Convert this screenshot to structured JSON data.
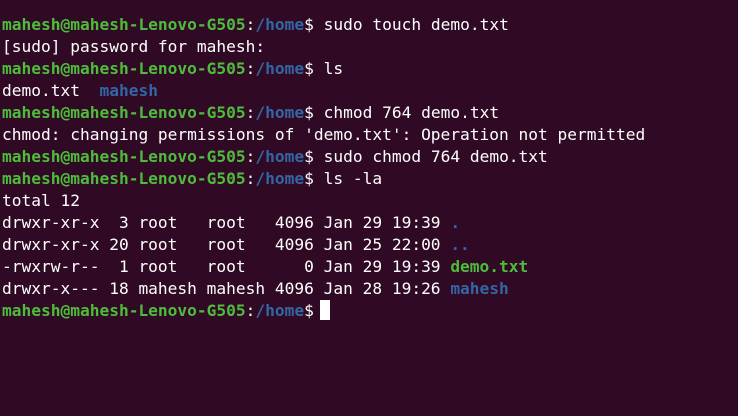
{
  "colors": {
    "background": "#300a24",
    "prompt_user": "#4ebc3b",
    "prompt_path": "#3465a4",
    "text": "#ffffff",
    "directory": "#3465a4",
    "executable": "#4ebc3b"
  },
  "prompt": {
    "user_host": "mahesh@mahesh-Lenovo-G505",
    "sep": ":",
    "path": "/home",
    "symbol": "$"
  },
  "lines": [
    {
      "type": "cmd",
      "command": "sudo touch demo.txt"
    },
    {
      "type": "out",
      "text": "[sudo] password for mahesh:"
    },
    {
      "type": "cmd",
      "command": "ls"
    },
    {
      "type": "ls",
      "file": "demo.txt",
      "gap": "  ",
      "dir": "mahesh"
    },
    {
      "type": "cmd",
      "command": "chmod 764 demo.txt"
    },
    {
      "type": "out",
      "text": "chmod: changing permissions of 'demo.txt': Operation not permitted"
    },
    {
      "type": "cmd",
      "command": "sudo chmod 764 demo.txt"
    },
    {
      "type": "cmd",
      "command": "ls -la"
    },
    {
      "type": "out",
      "text": "total 12"
    },
    {
      "type": "entry",
      "meta": "drwxr-xr-x  3 root   root   4096 Jan 29 19:39 ",
      "name": "."
    },
    {
      "type": "entry",
      "meta": "drwxr-xr-x 20 root   root   4096 Jan 25 22:00 ",
      "name": ".."
    },
    {
      "type": "entry_exe",
      "meta": "-rwxrw-r--  1 root   root      0 Jan 29 19:39 ",
      "name": "demo.txt"
    },
    {
      "type": "entry",
      "meta": "drwxr-x--- 18 mahesh mahesh 4096 Jan 28 19:26 ",
      "name": "mahesh"
    },
    {
      "type": "cmd",
      "command": ""
    }
  ]
}
